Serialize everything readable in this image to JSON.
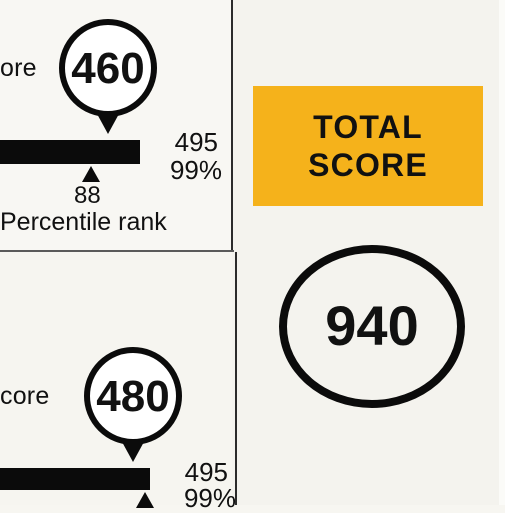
{
  "section1": {
    "label": "ore",
    "score": "460",
    "max": "495",
    "max_pct": "99%",
    "percentile": "88",
    "percentile_label": "Percentile rank"
  },
  "section2": {
    "label": "core",
    "score": "480",
    "max": "495",
    "max_pct": "99%"
  },
  "total": {
    "title_line1": "TOTAL",
    "title_line2": "SCORE",
    "score": "940"
  },
  "colors": {
    "accent": "#f5b21b",
    "ink": "#0b0b0b"
  }
}
